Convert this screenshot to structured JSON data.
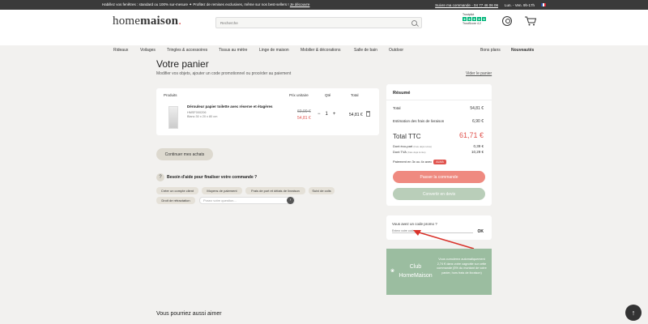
{
  "topbar": {
    "promo_text": "Habillez vos fenêtres : standard ou 100% sur-mesure ✦ Profitez de remises exclusives, même sur nos best-sellers ! ",
    "promo_link": "Je découvre",
    "phone_text": "Suivre ma commande - 04 77 46 06 06",
    "hours": "Lun. - Ven. 9h-17h"
  },
  "header": {
    "logo_home": "home",
    "logo_maison": "maison",
    "search_placeholder": "Recherche",
    "trustpilot_label": "Trustpilot",
    "trust_stars": [
      "★",
      "★",
      "★",
      "★",
      "★"
    ],
    "trust_rating": "TrustScore 4.2"
  },
  "nav": {
    "items": [
      "Rideaux",
      "Voilages",
      "Tringles & accessoires",
      "Tissus au mètre",
      "Linge de maison",
      "Mobilier & décorations",
      "Salle de bain",
      "Outdoor"
    ],
    "deals": "Bons plans",
    "new": "Nouveautés"
  },
  "cart": {
    "title": "Votre panier",
    "subtitle": "Modifier vos objets, ajouter un code promotionnel ou procéder au paiement",
    "empty_link": "Vider le panier",
    "headers": {
      "products": "Produits",
      "unit": "Prix unitaire",
      "qty": "Qté",
      "total": "Total"
    },
    "product": {
      "name": "Dérouleur papier toilette avec réserve et étagères",
      "ref": "HMSF000206",
      "size": "Blanc 30 x 20 x 80 cm",
      "old_price": "60,90 €",
      "new_price": "54,81 €",
      "qty_minus": "−",
      "qty": "1",
      "qty_plus": "+",
      "total": "54,81 €"
    },
    "continue": "Continuer mes achats"
  },
  "help": {
    "icon": "?",
    "title": "Besoin d'aide pour finaliser votre commande ?",
    "chips": [
      "Créer un compte client",
      "Moyens de paiement",
      "Frais de port et délais de livraison",
      "Suivi de colis",
      "Droit de rétractation"
    ],
    "question_placeholder": "Posez votre question...",
    "send": "›"
  },
  "summary": {
    "title": "Résumé",
    "total_label": "Total",
    "total_value": "54,81 €",
    "shipping_label": "Estimation des frais de livraison",
    "shipping_value": "6,90 €",
    "ttc_label": "Total TTC",
    "ttc_value": "61,71 €",
    "eco_label": "Dont éco-part",
    "eco_note": "(frais déjà inclus)",
    "eco_value": "0,39 €",
    "tva_label": "Dont TVA",
    "tva_value": "10,29 €",
    "pay_installments": "Paiement en 3x ou 4x avec",
    "alma": "ALMA",
    "checkout": "Passer la commande",
    "quote": "Convertir en devis"
  },
  "promo": {
    "label": "Vous avez un code promo ?",
    "placeholder": "Entrez votre code",
    "ok": "OK"
  },
  "club": {
    "name_line1": "Club",
    "name_line2": "HomeMaison",
    "text": "Vous cumulerez automatiquement 2,74 € dans votre cagnotte sur cette commande (5% du montant de votre panier, hors frais de livraison)"
  },
  "recos": {
    "title": "Vous pourriez aussi aimer"
  },
  "scrolltop": "↑",
  "colors": {
    "accent": "#e0544f",
    "checkout": "#ef8a80",
    "quote": "#9bbda0",
    "dark": "#3a3a3a",
    "bg": "#f2f1ef"
  }
}
